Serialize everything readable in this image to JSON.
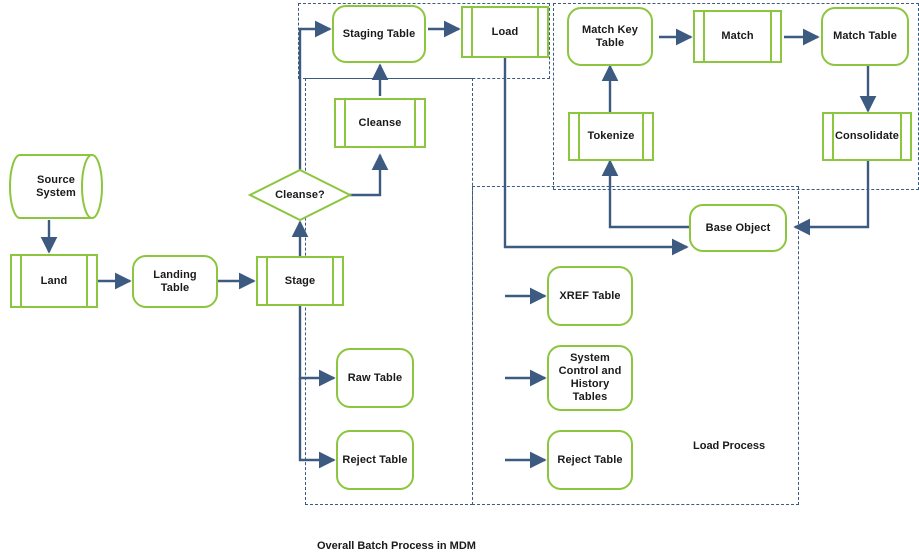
{
  "diagram": {
    "caption": "Overall Batch Process in MDM",
    "colors": {
      "shape_stroke": "#8CC63F",
      "connector": "#3d5a80",
      "dashed_group": "#3d5a80",
      "text": "#1a1a1a",
      "background": "#ffffff"
    },
    "groups": [
      {
        "id": "stage-group-outer",
        "label": ""
      },
      {
        "id": "stage-group-inner",
        "label": ""
      },
      {
        "id": "match-group",
        "label": ""
      },
      {
        "id": "load-group",
        "label": "Load Process"
      }
    ],
    "nodes": [
      {
        "id": "source-system",
        "label": "Source\nSystem",
        "shape": "database"
      },
      {
        "id": "land",
        "label": "Land",
        "shape": "predefined-process"
      },
      {
        "id": "landing-table",
        "label": "Landing Table",
        "shape": "rounded-rect"
      },
      {
        "id": "stage",
        "label": "Stage",
        "shape": "predefined-process"
      },
      {
        "id": "cleanse-decision",
        "label": "Cleanse?",
        "shape": "diamond"
      },
      {
        "id": "cleanse",
        "label": "Cleanse",
        "shape": "predefined-process"
      },
      {
        "id": "staging-table",
        "label": "Staging Table",
        "shape": "rounded-rect"
      },
      {
        "id": "load",
        "label": "Load",
        "shape": "predefined-process"
      },
      {
        "id": "raw-table",
        "label": "Raw Table",
        "shape": "rounded-rect"
      },
      {
        "id": "reject-table-stage",
        "label": "Reject Table",
        "shape": "rounded-rect"
      },
      {
        "id": "xref-table",
        "label": "XREF Table",
        "shape": "rounded-rect"
      },
      {
        "id": "system-control-history-tables",
        "label": "System\nControl and\nHistory Tables",
        "shape": "rounded-rect"
      },
      {
        "id": "reject-table-load",
        "label": "Reject Table",
        "shape": "rounded-rect"
      },
      {
        "id": "base-object",
        "label": "Base Object",
        "shape": "rounded-rect"
      },
      {
        "id": "match-key-table",
        "label": "Match Key\nTable",
        "shape": "rounded-rect"
      },
      {
        "id": "tokenize",
        "label": "Tokenize",
        "shape": "predefined-process"
      },
      {
        "id": "match",
        "label": "Match",
        "shape": "predefined-process"
      },
      {
        "id": "match-table",
        "label": "Match Table",
        "shape": "rounded-rect"
      },
      {
        "id": "consolidate",
        "label": "Consolidate",
        "shape": "predefined-process"
      }
    ],
    "edges": [
      {
        "from": "source-system",
        "to": "land"
      },
      {
        "from": "land",
        "to": "landing-table"
      },
      {
        "from": "landing-table",
        "to": "stage"
      },
      {
        "from": "stage",
        "to": "cleanse-decision"
      },
      {
        "from": "stage",
        "to": "raw-table"
      },
      {
        "from": "stage",
        "to": "reject-table-stage"
      },
      {
        "from": "cleanse-decision",
        "to": "cleanse"
      },
      {
        "from": "cleanse-decision",
        "to": "staging-table"
      },
      {
        "from": "cleanse",
        "to": "staging-table"
      },
      {
        "from": "staging-table",
        "to": "load"
      },
      {
        "from": "load",
        "to": "base-object"
      },
      {
        "from": "load",
        "to": "xref-table"
      },
      {
        "from": "load",
        "to": "system-control-history-tables"
      },
      {
        "from": "load",
        "to": "reject-table-load"
      },
      {
        "from": "base-object",
        "to": "tokenize"
      },
      {
        "from": "tokenize",
        "to": "match-key-table"
      },
      {
        "from": "match-key-table",
        "to": "match"
      },
      {
        "from": "match",
        "to": "match-table"
      },
      {
        "from": "match-table",
        "to": "consolidate"
      },
      {
        "from": "consolidate",
        "to": "base-object"
      }
    ]
  }
}
